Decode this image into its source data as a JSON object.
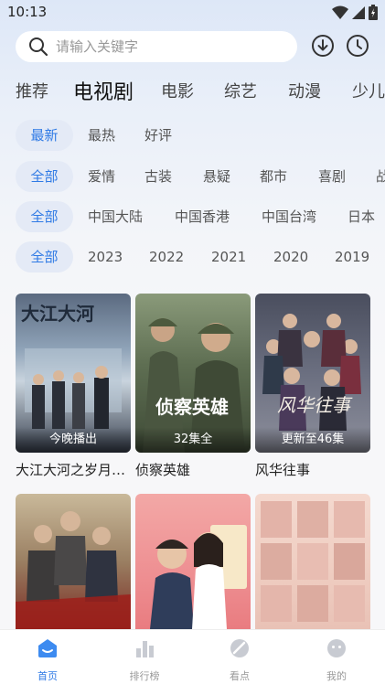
{
  "status": {
    "time": "10:13"
  },
  "search": {
    "placeholder": "请输入关键字"
  },
  "category_tabs": [
    "推荐",
    "电视剧",
    "电影",
    "综艺",
    "动漫",
    "少儿"
  ],
  "filters": {
    "sort": [
      "最新",
      "最热",
      "好评"
    ],
    "genre": [
      "全部",
      "爱情",
      "古装",
      "悬疑",
      "都市",
      "喜剧",
      "战"
    ],
    "region": [
      "全部",
      "中国大陆",
      "中国香港",
      "中国台湾",
      "日本"
    ],
    "year": [
      "全部",
      "2023",
      "2022",
      "2021",
      "2020",
      "2019"
    ]
  },
  "cards": [
    {
      "title": "大江大河之岁月…",
      "badge": "今晚播出",
      "poster_text": "大江大河"
    },
    {
      "title": "侦察英雄",
      "badge": "32集全",
      "poster_text": "侦察英雄"
    },
    {
      "title": "风华往事",
      "badge": "更新至46集",
      "poster_text": "风华往事"
    },
    {
      "title": "",
      "badge": ""
    },
    {
      "title": "",
      "badge": ""
    },
    {
      "title": "",
      "badge": ""
    }
  ],
  "bottom_nav": [
    "首页",
    "排行榜",
    "看点",
    "我的"
  ],
  "colors": {
    "accent": "#2f7ae5",
    "chip_bg": "#e4eaf6",
    "muted": "#999999"
  }
}
